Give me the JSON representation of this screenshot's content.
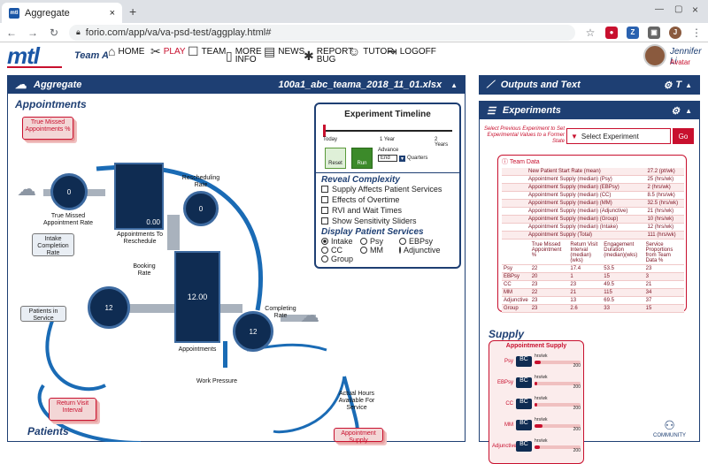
{
  "browser": {
    "tab_title": "Aggregate",
    "tab_close": "×",
    "new_tab": "+",
    "url": "forio.com/app/va/va-psd-test/aggplay.html#",
    "profile_initial": "J",
    "fav_text": "mtl"
  },
  "header": {
    "logo": "mtl",
    "team": "Team A",
    "nav": [
      {
        "label": "HOME",
        "icon": "home-icon",
        "glyph": "⌂"
      },
      {
        "label": "PLAY",
        "icon": "play-icon",
        "glyph": "✂"
      },
      {
        "label": "TEAM",
        "icon": "team-icon",
        "glyph": "☐"
      },
      {
        "label": "MORE\nINFO",
        "icon": "book-icon",
        "glyph": "▯"
      },
      {
        "label": "NEWS",
        "icon": "news-icon",
        "glyph": "▤"
      },
      {
        "label": "REPORT\nBUG",
        "icon": "bug-icon",
        "glyph": "✱"
      },
      {
        "label": "TUTOR",
        "icon": "tutor-icon",
        "glyph": "☺"
      },
      {
        "label": "LOGOFF",
        "icon": "logoff-icon",
        "glyph": "⇥"
      }
    ],
    "user_name": "Jennifer Li",
    "avatar_link": "Avatar"
  },
  "aggregate": {
    "title": "Aggregate",
    "file": "100a1_abc_teama_2018_11_01.xlsx",
    "appointments_title": "Appointments",
    "patients_title": "Patients",
    "true_missed_card": "True Missed Appointments %",
    "true_missed_rate": "True Missed Appointment Rate",
    "true_missed_value": "0",
    "appts_to_reschedule": "Appointments To Reschedule",
    "reschedule_stock_value": "0.00",
    "rescheduling_rate": "Rescheduling Rate",
    "rescheduling_value": "0",
    "intake_card": "Intake Completion Rate",
    "patients_in_service_card": "Patients in Service",
    "booking_rate": "Booking Rate",
    "booking_value": "12",
    "appointments_label": "Appointments",
    "appointments_value": "12.00",
    "completing_rate": "Completing Rate",
    "completing_value": "12",
    "work_pressure": "Work Pressure",
    "actual_hours": "Actual Hours Available For Service",
    "return_visit_card": "Return Visit Interval",
    "appointment_supply_card": "Appointment Supply"
  },
  "timeline": {
    "title": "Experiment Timeline",
    "ticks": [
      "Today",
      "1 Year",
      "2 Years"
    ],
    "reset": "Reset",
    "run": "Run",
    "advance": "Advance",
    "advance_value": "End",
    "quarters": "Quarters",
    "reveal_title": "Reveal Complexity",
    "reveal_items": [
      "Supply Affects Patient Services",
      "Effects of Overtime",
      "RVI and Wait Times",
      "Show Sensitivity Sliders"
    ],
    "display_title": "Display Patient Services",
    "services": [
      {
        "label": "Intake",
        "selected": true
      },
      {
        "label": "Psy",
        "selected": false
      },
      {
        "label": "EBPsy",
        "selected": false
      },
      {
        "label": "CC",
        "selected": false
      },
      {
        "label": "MM",
        "selected": false
      },
      {
        "label": "Adjunctive",
        "selected": false
      },
      {
        "label": "Group",
        "selected": false
      }
    ]
  },
  "outputs": {
    "title": "Outputs and Text",
    "experiments_title": "Experiments",
    "prompt": "Select Previous Experiment to Set Experimental Values to a Former State",
    "select_placeholder": "Select Experiment",
    "go": "Go",
    "team_data_title": "Team Data",
    "team_rows": [
      [
        "New Patient Start Rate (mean)",
        "27.2 (pt/wk)"
      ],
      [
        "Appointment Supply (median) (Psy)",
        "25 (hrs/wk)"
      ],
      [
        "Appointment Supply (median) (EBPsy)",
        "2 (hrs/wk)"
      ],
      [
        "Appointment Supply (median) (CC)",
        "8.5 (hrs/wk)"
      ],
      [
        "Appointment Supply (median) (MM)",
        "32.5 (hrs/wk)"
      ],
      [
        "Appointment Supply (median) (Adjunctive)",
        "21 (hrs/wk)"
      ],
      [
        "Appointment Supply (median) (Group)",
        "10 (hrs/wk)"
      ],
      [
        "Appointment Supply (median) (Intake)",
        "12 (hrs/wk)"
      ],
      [
        "Appointment Supply (Total)",
        "111 (hrs/wk)"
      ]
    ],
    "service_headers": [
      "",
      "True Missed Appointment %",
      "Return Visit Interval (median) (wks)",
      "Engagement Duration (median)(wks)",
      "Service Proportions from Team Data %"
    ],
    "service_rows": [
      [
        "Psy",
        "22",
        "17.4",
        "53.5",
        "23"
      ],
      [
        "EBPsy",
        "20",
        "1",
        "15",
        "3"
      ],
      [
        "CC",
        "23",
        "23",
        "49.5",
        "21"
      ],
      [
        "MM",
        "22",
        "21",
        "115",
        "34"
      ],
      [
        "Adjunctive",
        "23",
        "13",
        "69.5",
        "37"
      ],
      [
        "Group",
        "23",
        "2.6",
        "33",
        "15"
      ]
    ],
    "supply_title": "Supply",
    "supply_box_title": "Appointment Supply",
    "supply_rows": [
      {
        "label": "Psy",
        "bc": "BC",
        "unit": "hrs/wk",
        "max": "200",
        "fill": 0.13
      },
      {
        "label": "EBPsy",
        "bc": "BC",
        "unit": "hrs/wk",
        "max": "200",
        "fill": 0.02
      },
      {
        "label": "CC",
        "bc": "BC",
        "unit": "hrs/wk",
        "max": "200",
        "fill": 0.05
      },
      {
        "label": "MM",
        "bc": "BC",
        "unit": "hrs/wk",
        "max": "200",
        "fill": 0.17
      },
      {
        "label": "Adjunctive",
        "bc": "BC",
        "unit": "hrs/wk",
        "max": "200",
        "fill": 0.11
      }
    ],
    "community": "COMMUNITY"
  },
  "colors": {
    "navy": "#1e3f73",
    "red": "#c8102e",
    "stock": "#0f2c52"
  }
}
